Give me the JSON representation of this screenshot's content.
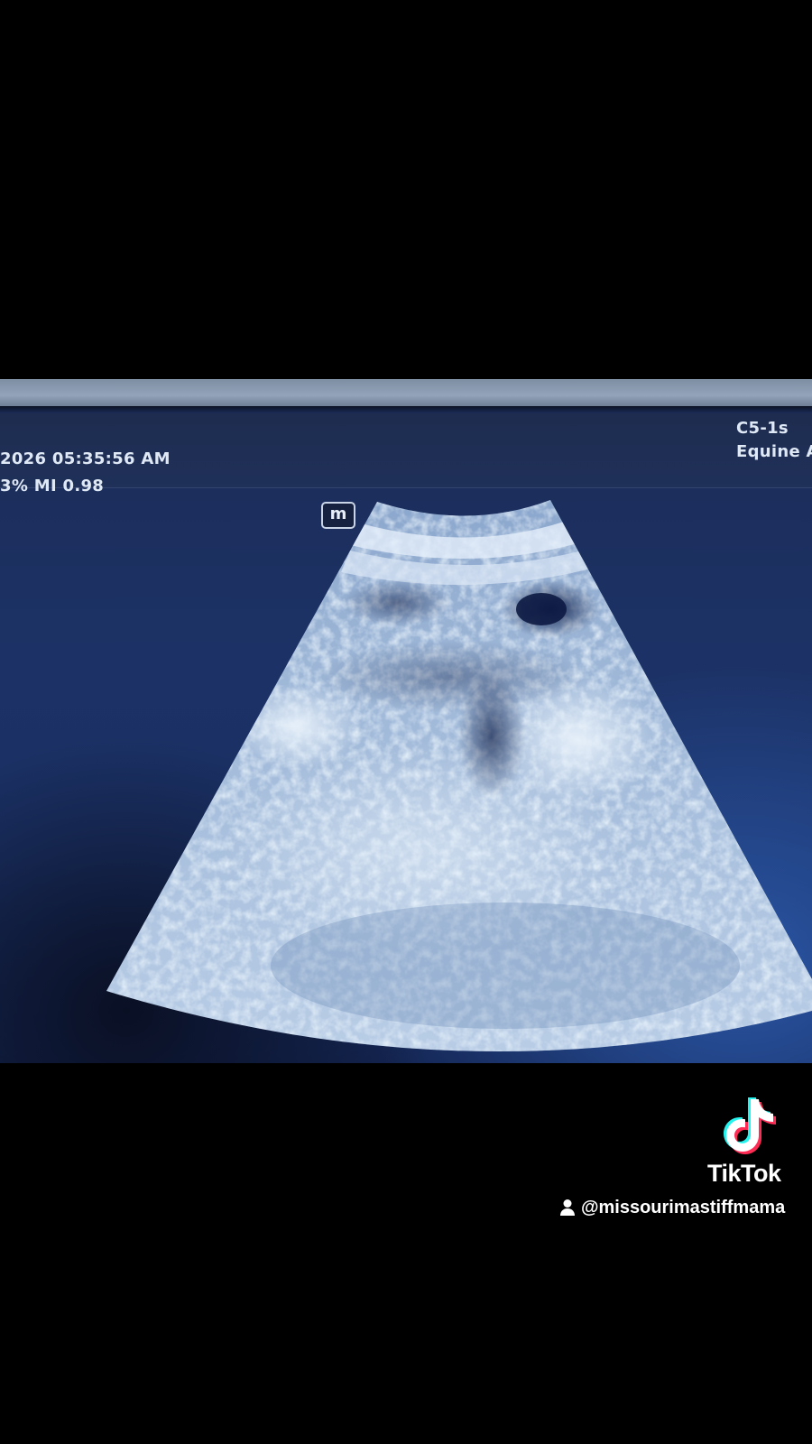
{
  "ultrasound": {
    "datetime": "2026  05:35:56 AM",
    "power_mi": "3%  MI 0.98",
    "probe": "C5-1s",
    "preset": "Equine Ab",
    "orientation_marker": "m"
  },
  "watermark": {
    "brand": "TikTok",
    "handle": "@missourimastiffmama",
    "logo_icon": "tiktok-note-icon",
    "user_icon": "person-icon"
  },
  "colors": {
    "background": "#000000",
    "screen_blue": "#1c3266",
    "tiktok_cyan": "#25f4ee",
    "tiktok_red": "#fe2c55"
  }
}
